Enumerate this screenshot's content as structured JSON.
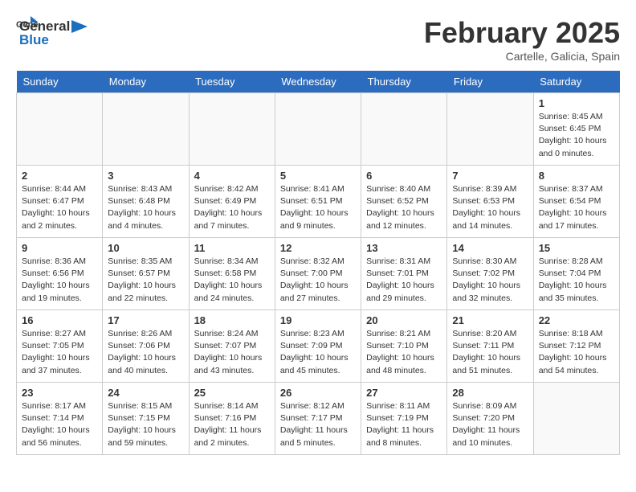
{
  "logo": {
    "general": "General",
    "blue": "Blue"
  },
  "title": "February 2025",
  "subtitle": "Cartelle, Galicia, Spain",
  "days_of_week": [
    "Sunday",
    "Monday",
    "Tuesday",
    "Wednesday",
    "Thursday",
    "Friday",
    "Saturday"
  ],
  "weeks": [
    [
      {
        "num": "",
        "detail": ""
      },
      {
        "num": "",
        "detail": ""
      },
      {
        "num": "",
        "detail": ""
      },
      {
        "num": "",
        "detail": ""
      },
      {
        "num": "",
        "detail": ""
      },
      {
        "num": "",
        "detail": ""
      },
      {
        "num": "1",
        "detail": "Sunrise: 8:45 AM\nSunset: 6:45 PM\nDaylight: 10 hours\nand 0 minutes."
      }
    ],
    [
      {
        "num": "2",
        "detail": "Sunrise: 8:44 AM\nSunset: 6:47 PM\nDaylight: 10 hours\nand 2 minutes."
      },
      {
        "num": "3",
        "detail": "Sunrise: 8:43 AM\nSunset: 6:48 PM\nDaylight: 10 hours\nand 4 minutes."
      },
      {
        "num": "4",
        "detail": "Sunrise: 8:42 AM\nSunset: 6:49 PM\nDaylight: 10 hours\nand 7 minutes."
      },
      {
        "num": "5",
        "detail": "Sunrise: 8:41 AM\nSunset: 6:51 PM\nDaylight: 10 hours\nand 9 minutes."
      },
      {
        "num": "6",
        "detail": "Sunrise: 8:40 AM\nSunset: 6:52 PM\nDaylight: 10 hours\nand 12 minutes."
      },
      {
        "num": "7",
        "detail": "Sunrise: 8:39 AM\nSunset: 6:53 PM\nDaylight: 10 hours\nand 14 minutes."
      },
      {
        "num": "8",
        "detail": "Sunrise: 8:37 AM\nSunset: 6:54 PM\nDaylight: 10 hours\nand 17 minutes."
      }
    ],
    [
      {
        "num": "9",
        "detail": "Sunrise: 8:36 AM\nSunset: 6:56 PM\nDaylight: 10 hours\nand 19 minutes."
      },
      {
        "num": "10",
        "detail": "Sunrise: 8:35 AM\nSunset: 6:57 PM\nDaylight: 10 hours\nand 22 minutes."
      },
      {
        "num": "11",
        "detail": "Sunrise: 8:34 AM\nSunset: 6:58 PM\nDaylight: 10 hours\nand 24 minutes."
      },
      {
        "num": "12",
        "detail": "Sunrise: 8:32 AM\nSunset: 7:00 PM\nDaylight: 10 hours\nand 27 minutes."
      },
      {
        "num": "13",
        "detail": "Sunrise: 8:31 AM\nSunset: 7:01 PM\nDaylight: 10 hours\nand 29 minutes."
      },
      {
        "num": "14",
        "detail": "Sunrise: 8:30 AM\nSunset: 7:02 PM\nDaylight: 10 hours\nand 32 minutes."
      },
      {
        "num": "15",
        "detail": "Sunrise: 8:28 AM\nSunset: 7:04 PM\nDaylight: 10 hours\nand 35 minutes."
      }
    ],
    [
      {
        "num": "16",
        "detail": "Sunrise: 8:27 AM\nSunset: 7:05 PM\nDaylight: 10 hours\nand 37 minutes."
      },
      {
        "num": "17",
        "detail": "Sunrise: 8:26 AM\nSunset: 7:06 PM\nDaylight: 10 hours\nand 40 minutes."
      },
      {
        "num": "18",
        "detail": "Sunrise: 8:24 AM\nSunset: 7:07 PM\nDaylight: 10 hours\nand 43 minutes."
      },
      {
        "num": "19",
        "detail": "Sunrise: 8:23 AM\nSunset: 7:09 PM\nDaylight: 10 hours\nand 45 minutes."
      },
      {
        "num": "20",
        "detail": "Sunrise: 8:21 AM\nSunset: 7:10 PM\nDaylight: 10 hours\nand 48 minutes."
      },
      {
        "num": "21",
        "detail": "Sunrise: 8:20 AM\nSunset: 7:11 PM\nDaylight: 10 hours\nand 51 minutes."
      },
      {
        "num": "22",
        "detail": "Sunrise: 8:18 AM\nSunset: 7:12 PM\nDaylight: 10 hours\nand 54 minutes."
      }
    ],
    [
      {
        "num": "23",
        "detail": "Sunrise: 8:17 AM\nSunset: 7:14 PM\nDaylight: 10 hours\nand 56 minutes."
      },
      {
        "num": "24",
        "detail": "Sunrise: 8:15 AM\nSunset: 7:15 PM\nDaylight: 10 hours\nand 59 minutes."
      },
      {
        "num": "25",
        "detail": "Sunrise: 8:14 AM\nSunset: 7:16 PM\nDaylight: 11 hours\nand 2 minutes."
      },
      {
        "num": "26",
        "detail": "Sunrise: 8:12 AM\nSunset: 7:17 PM\nDaylight: 11 hours\nand 5 minutes."
      },
      {
        "num": "27",
        "detail": "Sunrise: 8:11 AM\nSunset: 7:19 PM\nDaylight: 11 hours\nand 8 minutes."
      },
      {
        "num": "28",
        "detail": "Sunrise: 8:09 AM\nSunset: 7:20 PM\nDaylight: 11 hours\nand 10 minutes."
      },
      {
        "num": "",
        "detail": ""
      }
    ]
  ]
}
